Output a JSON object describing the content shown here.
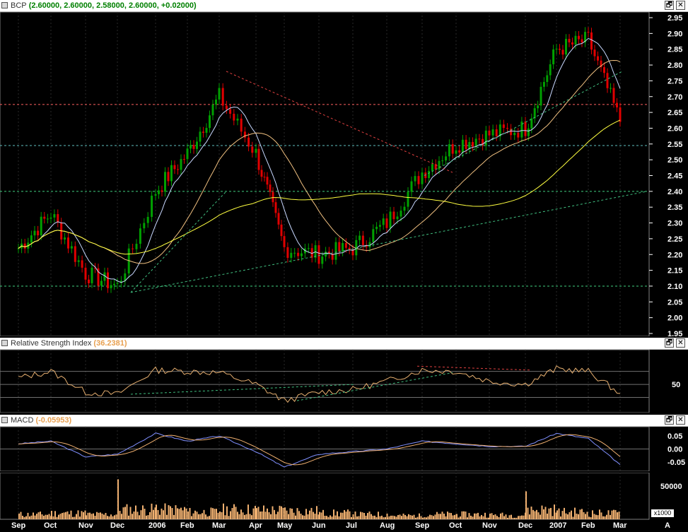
{
  "price_pane": {
    "symbol": "BCP",
    "ohlc_readout": "(2.60000, 2.60000, 2.58000, 2.60000, +0.02000)",
    "y_ticks": [
      "2.95",
      "2.90",
      "2.85",
      "2.80",
      "2.75",
      "2.70",
      "2.65",
      "2.60",
      "2.55",
      "2.50",
      "2.45",
      "2.40",
      "2.35",
      "2.30",
      "2.25",
      "2.20",
      "2.15",
      "2.10",
      "2.05",
      "2.00",
      "1.95"
    ],
    "colors": {
      "up": "#00a000",
      "down": "#e00000",
      "ma_short": "#c8d8ff",
      "ma_mid": "#f0c080",
      "ma_long": "#ffff40"
    }
  },
  "rsi_pane": {
    "title": "Relative Strength Index",
    "value": "(36.2381)",
    "y_ticks": [
      "50"
    ],
    "color": "#e8b070"
  },
  "macd_pane": {
    "title": "MACD",
    "value": "(-0.05953)",
    "y_ticks": [
      "0.05",
      "0.00",
      "-0.05"
    ]
  },
  "volume_pane": {
    "y_ticks": [
      "50000"
    ],
    "unit": "x1000",
    "color": "#f0b070"
  },
  "x_axis": [
    "Sep",
    "Oct",
    "Nov",
    "Dec",
    "2006",
    "Feb",
    "Mar",
    "Apr",
    "May",
    "Jun",
    "Jul",
    "Aug",
    "Sep",
    "Oct",
    "Nov",
    "Dec",
    "2007",
    "Feb",
    "Mar",
    "A"
  ],
  "buttons": {
    "restore": "🗗",
    "close": "✕"
  },
  "chart_data": [
    {
      "type": "line",
      "title": "BCP",
      "x": [
        "Sep",
        "Oct",
        "Nov",
        "Dec",
        "2006",
        "Feb",
        "Mar",
        "Apr",
        "May",
        "Jun",
        "Jul",
        "Aug",
        "Sep",
        "Oct",
        "Nov",
        "Dec",
        "2007",
        "Feb",
        "Mar"
      ],
      "series": [
        {
          "name": "BCP",
          "values": [
            2.22,
            2.33,
            2.14,
            2.1,
            2.4,
            2.52,
            2.7,
            2.52,
            2.22,
            2.2,
            2.22,
            2.3,
            2.46,
            2.55,
            2.58,
            2.6,
            2.85,
            2.88,
            2.62
          ]
        }
      ],
      "ylim": [
        1.95,
        2.95
      ]
    },
    {
      "type": "line",
      "title": "Relative Strength Index",
      "x": [
        "Sep",
        "Oct",
        "Nov",
        "Dec",
        "2006",
        "Feb",
        "Mar",
        "Apr",
        "May",
        "Jun",
        "Jul",
        "Aug",
        "Sep",
        "Oct",
        "Nov",
        "Dec",
        "2007",
        "Feb",
        "Mar"
      ],
      "series": [
        {
          "name": "Relative Strength Index",
          "values": [
            60,
            70,
            38,
            35,
            72,
            70,
            68,
            50,
            25,
            38,
            42,
            55,
            72,
            70,
            55,
            50,
            74,
            70,
            36
          ]
        }
      ]
    },
    {
      "type": "line",
      "title": "MACD",
      "x": [
        "Sep",
        "Oct",
        "Nov",
        "Dec",
        "2006",
        "Feb",
        "Mar",
        "Apr",
        "May",
        "Jun",
        "Jul",
        "Aug",
        "Sep",
        "Oct",
        "Nov",
        "Dec",
        "2007",
        "Feb",
        "Mar"
      ],
      "series": [
        {
          "name": "MACD",
          "values": [
            0.02,
            0.03,
            -0.03,
            -0.02,
            0.06,
            0.03,
            0.05,
            -0.01,
            -0.07,
            -0.02,
            -0.01,
            0.0,
            0.03,
            0.02,
            0.01,
            0.01,
            0.06,
            0.04,
            -0.06
          ]
        }
      ],
      "ylim": [
        -0.08,
        0.08
      ]
    },
    {
      "type": "bar",
      "x": [
        "Sep",
        "Oct",
        "Nov",
        "Dec",
        "2006",
        "Feb",
        "Mar",
        "Apr",
        "May",
        "Jun",
        "Jul",
        "Aug",
        "Sep",
        "Oct",
        "Nov",
        "Dec",
        "2007",
        "Feb",
        "Mar"
      ],
      "series": [
        {
          "name": "Volume",
          "values": [
            8000,
            10000,
            8000,
            60000,
            22000,
            12000,
            18000,
            15000,
            14000,
            10000,
            8000,
            6000,
            8000,
            8000,
            7000,
            42000,
            12000,
            10000,
            10000
          ]
        }
      ],
      "ylabel": "x1000"
    }
  ]
}
